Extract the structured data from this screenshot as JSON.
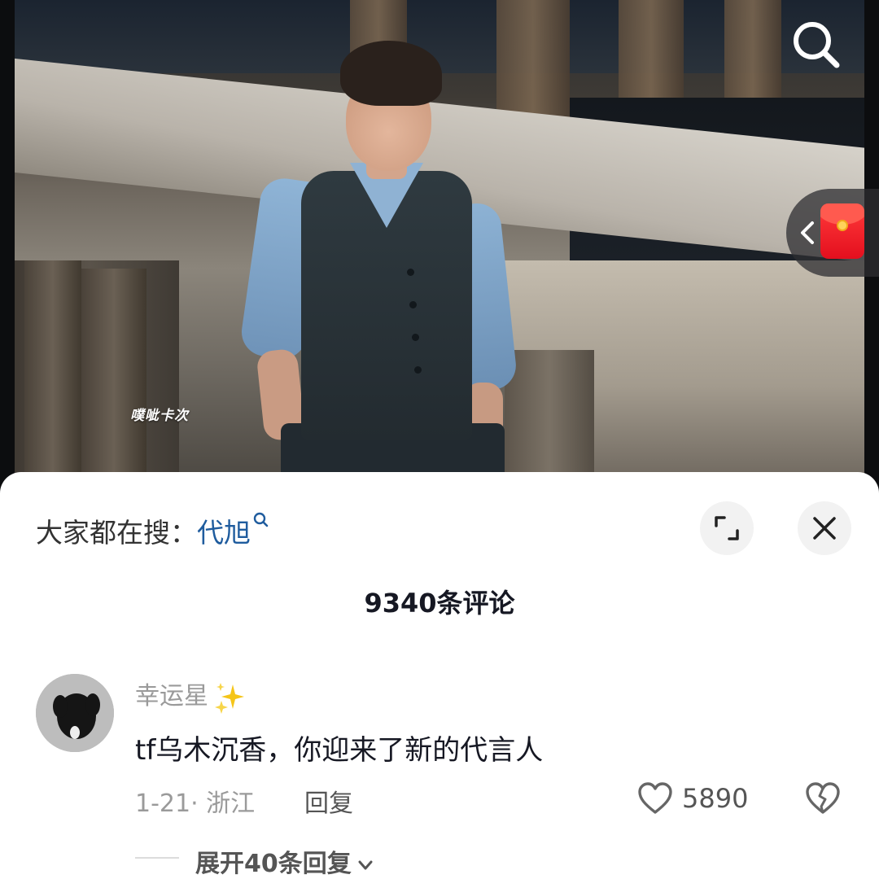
{
  "video": {
    "watermark": "噗呲卡次"
  },
  "hot_search": {
    "prefix": "大家都在搜：",
    "keyword": "代旭"
  },
  "comments": {
    "count_label": "9340条评论",
    "items": [
      {
        "username": "幸运星",
        "text": "tf乌木沉香，你迎来了新的代言人",
        "date_location": "1-21· 浙江",
        "reply_label": "回复",
        "likes": "5890",
        "expand_label": "展开40条回复"
      }
    ]
  },
  "colors": {
    "keyword_blue": "#1f5c9e",
    "red_packet": "#e40f1e",
    "muted_text": "#9a9a9a",
    "primary_text": "#161823"
  },
  "icons": [
    "search-icon",
    "red-packet-icon",
    "chevron-left-icon",
    "expand-icon",
    "close-icon",
    "sparkle-icon",
    "heart-icon",
    "broken-heart-icon",
    "chevron-down-icon"
  ]
}
